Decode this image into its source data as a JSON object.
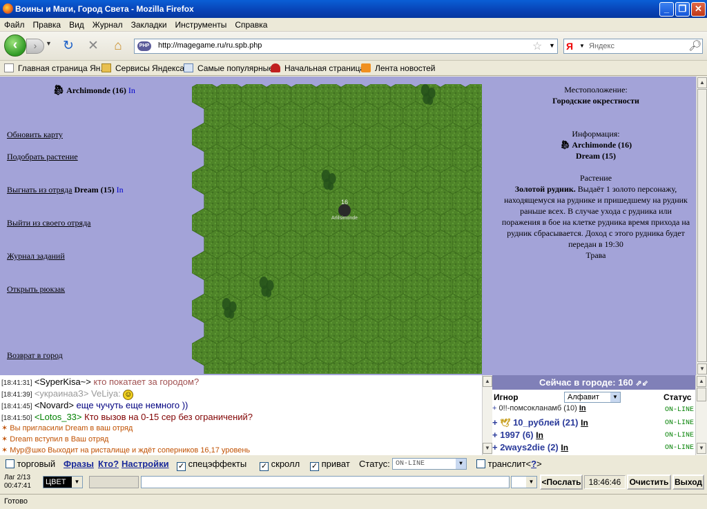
{
  "window": {
    "title": "Воины и Маги, Город Света - Mozilla Firefox"
  },
  "menu": [
    "Файл",
    "Правка",
    "Вид",
    "Журнал",
    "Закладки",
    "Инструменты",
    "Справка"
  ],
  "nav": {
    "url": "http://magegame.ru/ru.spb.php",
    "search_placeholder": "Яндекс",
    "search_logo": "Я"
  },
  "bookmarks": [
    {
      "label": "Главная страница Ян...",
      "icon": "page-icon"
    },
    {
      "label": "Сервисы Яндекса",
      "icon": "folder-icon"
    },
    {
      "label": "Самые популярные",
      "icon": "search-page-icon"
    },
    {
      "label": "Начальная страница",
      "icon": "mushroom-icon"
    },
    {
      "label": "Лента новостей",
      "icon": "rss-icon"
    }
  ],
  "player": {
    "name": "Archimonde (16)",
    "in": "In"
  },
  "left_menu": {
    "refresh": "Обновить карту",
    "pickup": "Подобрать растение",
    "kick": "Выгнать из отряда",
    "kick_target": "Dream (15)",
    "kick_in": "In",
    "leave": "Выйти из своего отряда",
    "journal": "Журнал заданий",
    "backpack": "Открыть рюкзак",
    "return": "Возврат в город"
  },
  "map": {
    "unit_level": "16",
    "unit_label": "Arlilsimonde",
    "cols": 12,
    "rows": 14,
    "trees": [
      [
        9,
        0
      ],
      [
        5,
        4
      ],
      [
        2,
        9
      ],
      [
        1,
        10
      ]
    ]
  },
  "info": {
    "location_label": "Местоположение:",
    "location": "Городские окрестности",
    "info_label": "Информация:",
    "info_player": "Archimonde (16)",
    "info_companion": "Dream (15)",
    "plant_label": "Растение",
    "mine_name": "Золотой рудник.",
    "mine_desc": "Выдаёт 1 золото персонажу, находящемуся на руднике и пришедшему на рудник раньше всех. В случае ухода с рудника или поражения в бое на клетке рудника время прихода на рудник сбрасывается. Доход с этого рудника будет передан в 19:30",
    "terrain": "Трава"
  },
  "chat": [
    {
      "time": "[18:41:31]",
      "nick": "<SyperKisa~>",
      "nick_color": "#000000",
      "text": " кто покатает за городом?",
      "text_color": "#a05050"
    },
    {
      "time": "[18:41:39]",
      "nick": "<украинааЗ>",
      "nick_color": "#999999",
      "text": " VeLiya: ",
      "text_color": "#999999",
      "smiley": "☺"
    },
    {
      "time": "[18:41:45]",
      "nick": "<Novard>",
      "nick_color": "#000000",
      "text": " еще чучуть еще немного ))",
      "text_color": "#000080"
    },
    {
      "time": "[18:41:50]",
      "nick": "<Lotos_33>",
      "nick_color": "#008000",
      "text": " Кто вызов на 0-15 сер без ограничений?",
      "text_color": "#800000"
    },
    {
      "time": "",
      "nick": "",
      "nick_color": "#000",
      "text": "Вы пригласили Dream в ваш отряд",
      "text_color": "#c05000",
      "system": true
    },
    {
      "time": "",
      "nick": "",
      "nick_color": "#000",
      "text": "Dream вступил в Ваш отряд",
      "text_color": "#c05000",
      "system": true
    },
    {
      "time": "",
      "nick": "",
      "nick_color": "#000",
      "text": "Мур@шко Выходит на ристалище и ждёт соперников 16,17 уровень",
      "text_color": "#c05000",
      "system": true
    }
  ],
  "users": {
    "header": "Сейчас в городе: 160",
    "ignore": "Игнор",
    "sort": "Алфавит",
    "status": "Статус",
    "list": [
      {
        "name": "0!!-помсокланамб (10)",
        "in": "In",
        "status": "ON-LINE",
        "small": true
      },
      {
        "name": "10_рублей (21)",
        "in": "In",
        "status": "ON-LINE"
      },
      {
        "name": "1997 (6)",
        "in": "In",
        "status": "ON-LINE"
      },
      {
        "name": "2ways2die (2)",
        "in": "In",
        "status": "ON-LINE"
      }
    ]
  },
  "controls": {
    "trade": "торговый",
    "phrases": "Фразы",
    "who": "Кто?",
    "settings": "Настройки",
    "effects": "спецэффекты",
    "scroll": "скролл",
    "private": "приват",
    "status_label": "Статус:",
    "status_value": "ON-LINE",
    "translit": "транслит<",
    "translit_q": "?",
    "translit_end": ">"
  },
  "input": {
    "lag": "Лаг 2/13",
    "timer": "00:47:41",
    "color": "ЦВЕТ",
    "send": "<Послать",
    "time": "18:46:46",
    "clear": "Очистить",
    "exit": "Выход"
  },
  "status": "Готово"
}
